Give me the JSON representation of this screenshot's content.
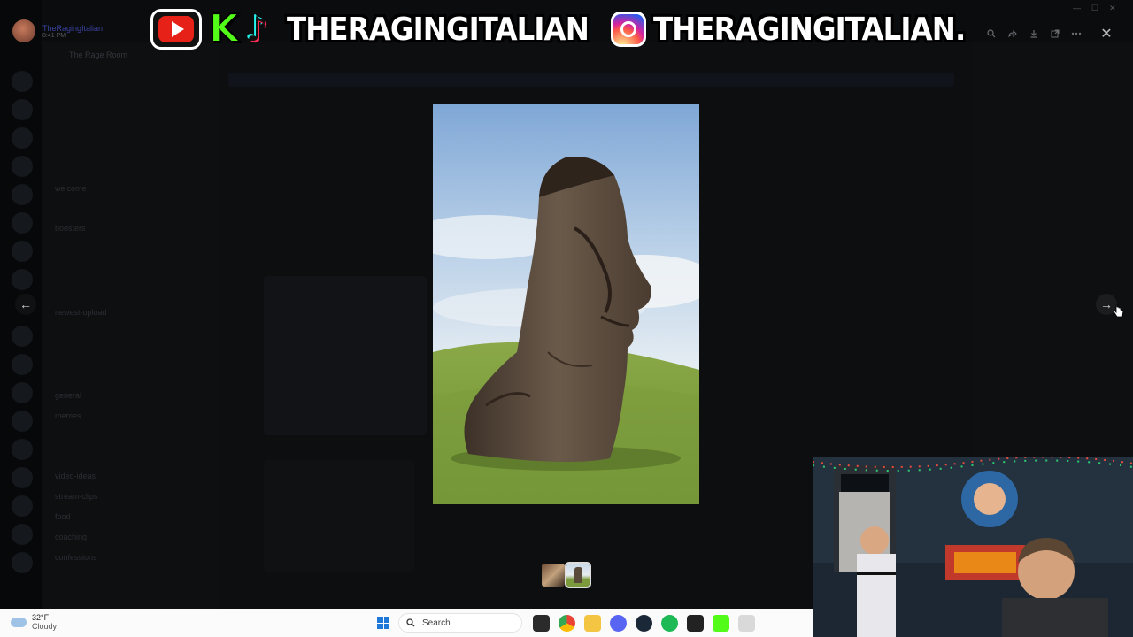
{
  "branding": {
    "k_letter": "K",
    "tiktok_letter": "♪",
    "handle_primary": "THERAGINGITALIAN",
    "handle_secondary": "THERAGINGITALIAN."
  },
  "background": {
    "username": "TheRagingItalian",
    "user_time": "8:41 PM",
    "server_name": "The Rage Room",
    "channels": [
      "welcome",
      "boosters",
      "newest-upload",
      "general",
      "memes",
      "video-ideas",
      "stream-clips",
      "food",
      "coaching",
      "confessions"
    ]
  },
  "viewer": {
    "toolbar_icons": [
      "zoom-icon",
      "forward-icon",
      "download-icon",
      "open-external-icon",
      "more-icon"
    ],
    "close_label": "✕",
    "prev_label": "←",
    "next_label": "→",
    "image_alt": "Moai statue on a grassy hillside"
  },
  "taskbar": {
    "weather_temp": "32°F",
    "weather_desc": "Cloudy",
    "search_placeholder": "Search",
    "apps": [
      "file-explorer-icon",
      "chrome-icon",
      "folder-icon",
      "discord-icon",
      "steam-icon",
      "spotify-icon",
      "epic-games-icon",
      "kick-icon",
      "vm-icon"
    ]
  },
  "colors": {
    "youtube": "#e62117",
    "kick": "#53fc18",
    "windows_blue": "#1e78d7",
    "discord": "#5865f2",
    "spotify": "#1db954"
  }
}
